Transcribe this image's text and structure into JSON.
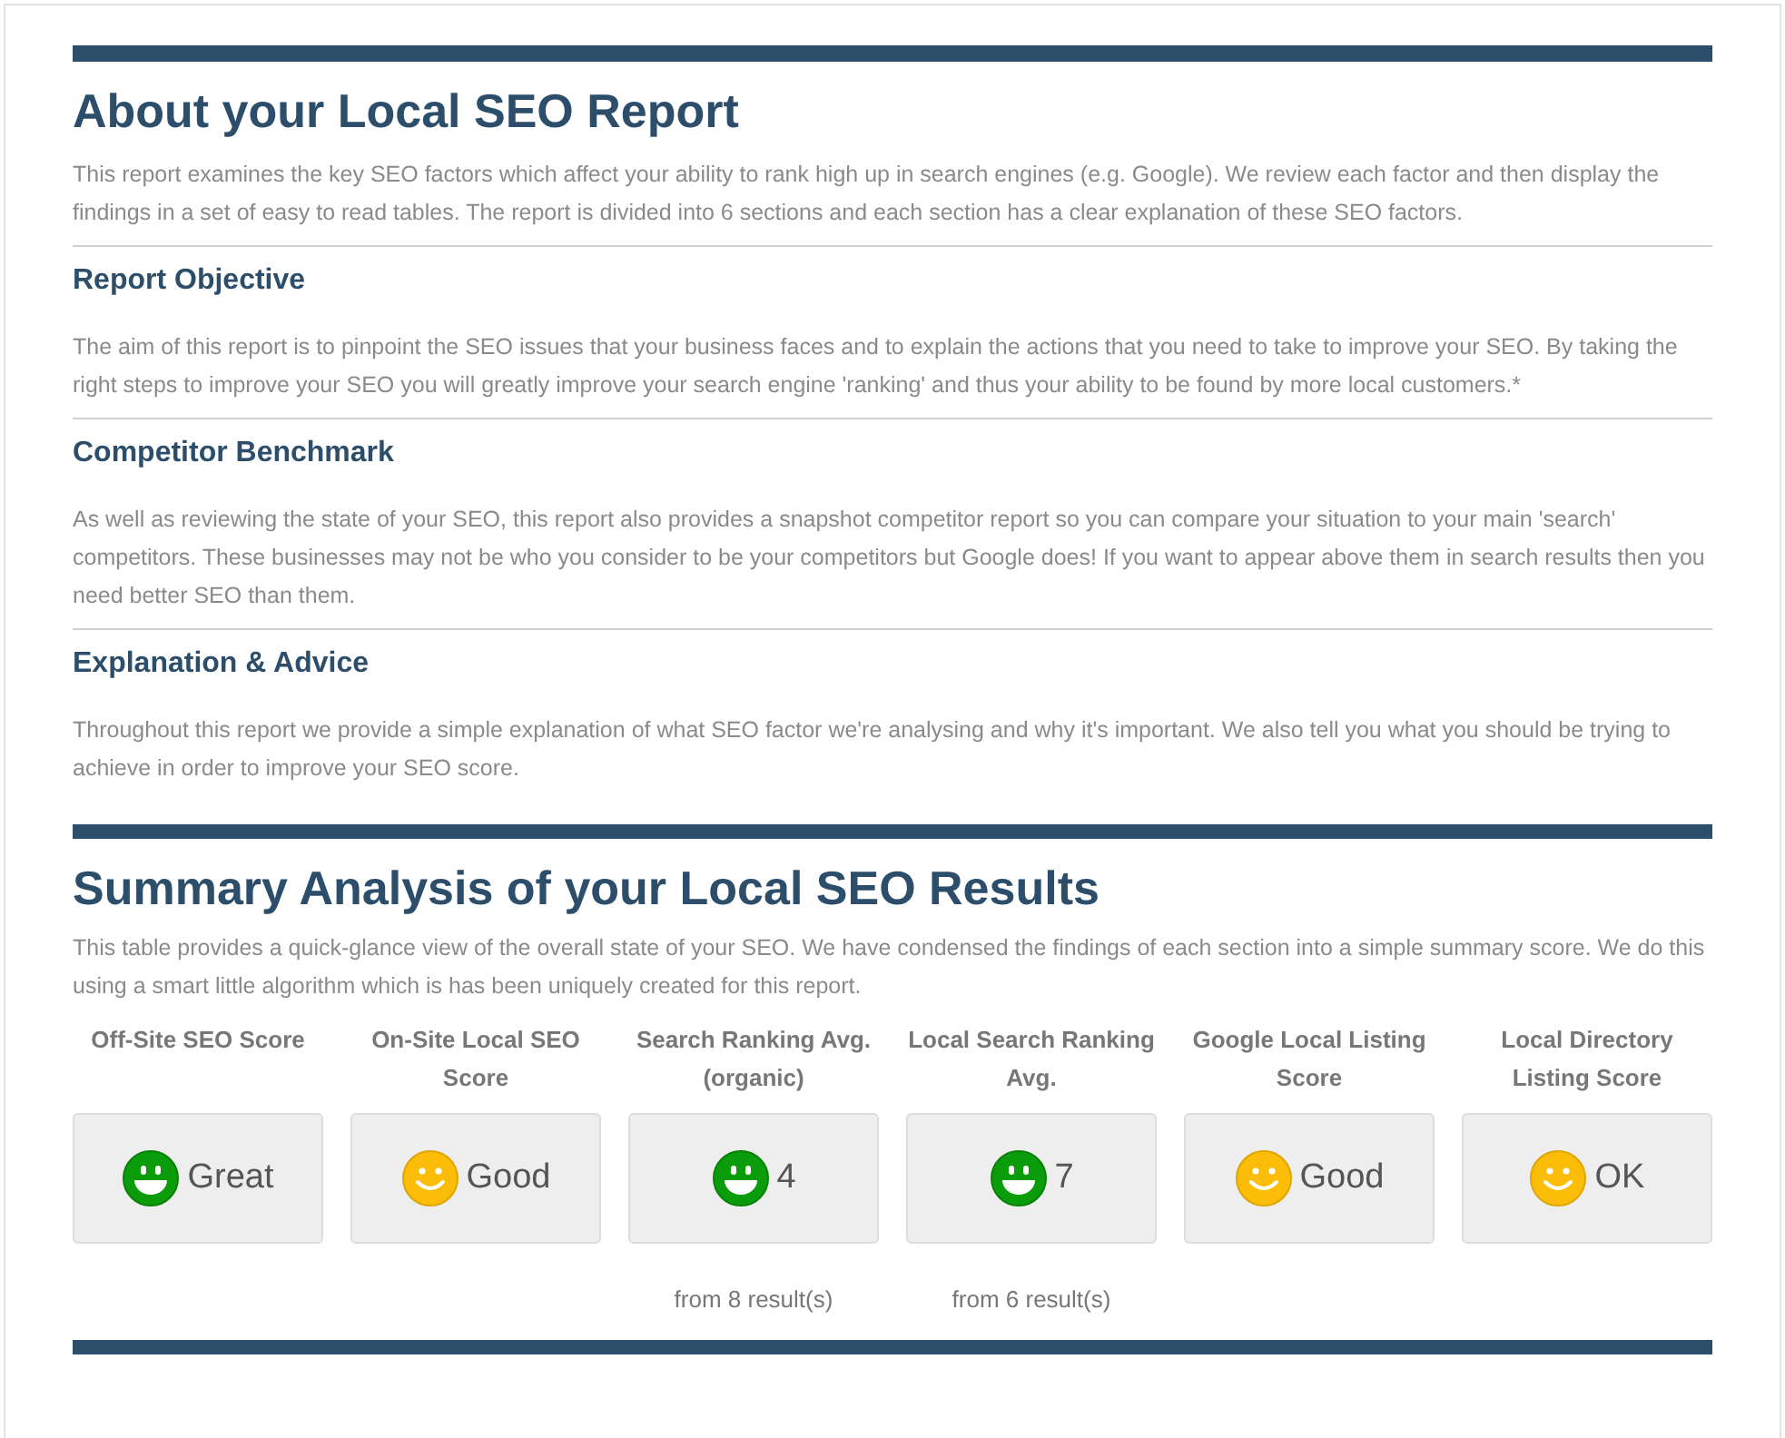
{
  "about": {
    "title": "About your Local SEO Report",
    "intro": "This report examines the key SEO factors which affect your ability to rank high up in search engines (e.g. Google). We review each factor and then display the findings in a set of easy to read tables. The report is divided into 6 sections and each section has a clear explanation of these SEO factors.",
    "sections": [
      {
        "heading": "Report Objective",
        "text": "The aim of this report is to pinpoint the SEO issues that your business faces and to explain the actions that you need to take to improve your SEO. By taking the right steps to improve your SEO you will greatly improve your search engine 'ranking' and thus your ability to be found by more local customers.*"
      },
      {
        "heading": "Competitor Benchmark",
        "text": "As well as reviewing the state of your SEO, this report also provides a snapshot competitor report so you can compare your situation to your main 'search' competitors. These businesses may not be who you consider to be your competitors but Google does! If you want to appear above them in search results then you need better SEO than them."
      },
      {
        "heading": "Explanation & Advice",
        "text": "Throughout this report we provide a simple explanation of what SEO factor we're analysing and why it's important. We also tell you what you should be trying to achieve in order to improve your SEO score."
      }
    ]
  },
  "summary": {
    "title": "Summary Analysis of your Local SEO Results",
    "intro": "This table provides a quick-glance view of the overall state of your SEO. We have condensed the findings of each section into a simple summary score. We do this using a smart little algorithm which is has been uniquely created for this report.",
    "scores": [
      {
        "label": "Off-Site SEO Score",
        "kind": "great",
        "value": "Great"
      },
      {
        "label": "On-Site Local SEO Score",
        "kind": "good",
        "value": "Good"
      },
      {
        "label": "Search Ranking Avg. (organic)",
        "kind": "great",
        "value": "4",
        "note": "from 8 result(s)"
      },
      {
        "label": "Local Search Ranking Avg.",
        "kind": "great",
        "value": "7",
        "note": "from 6 result(s)"
      },
      {
        "label": "Google Local Listing Score",
        "kind": "good",
        "value": "Good"
      },
      {
        "label": "Local Directory Listing Score",
        "kind": "good",
        "value": "OK"
      }
    ]
  }
}
